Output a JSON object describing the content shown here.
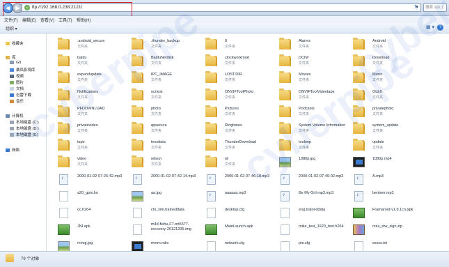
{
  "address": {
    "path": "ftp://192.168.0.238:2121/",
    "search_placeholder": "搜索 192.1..."
  },
  "menu": [
    "文件(F)",
    "编辑(E)",
    "查看(V)",
    "工具(T)",
    "帮助(H)"
  ],
  "toolbar": {
    "organize": "组织 ▾"
  },
  "sidebar": {
    "favorites": "收藏夹",
    "libraries": "库",
    "lib_items": [
      "Git",
      "暴风影视库",
      "视频",
      "图片",
      "文档",
      "迅雷下载",
      "音乐"
    ],
    "computer": "计算机",
    "drives": [
      "本地磁盘 (C:)",
      "本地磁盘 (D:)",
      "本地磁盘 (E:)"
    ],
    "network": "网络"
  },
  "folder_type": "文件夹",
  "items": [
    {
      "name": ".android_secure",
      "kind": "folder"
    },
    {
      "name": ".thunder_backup",
      "kind": "folder"
    },
    {
      "name": "0",
      "kind": "folder"
    },
    {
      "name": "Alarms",
      "kind": "folder"
    },
    {
      "name": "Android",
      "kind": "folder"
    },
    {
      "name": "baidu",
      "kind": "folder"
    },
    {
      "name": "BaiduNetdisk",
      "kind": "folder"
    },
    {
      "name": "clockworkmod",
      "kind": "folder"
    },
    {
      "name": "DCIM",
      "kind": "folder"
    },
    {
      "name": "Download",
      "kind": "folder"
    },
    {
      "name": "expandupdate",
      "kind": "folder"
    },
    {
      "name": "IPC_IMAGE",
      "kind": "folder"
    },
    {
      "name": "LOST.DIR",
      "kind": "folder"
    },
    {
      "name": "Movies",
      "kind": "folder"
    },
    {
      "name": "Music",
      "kind": "folder"
    },
    {
      "name": "Notifications",
      "kind": "folder"
    },
    {
      "name": "ocrtest",
      "kind": "folder"
    },
    {
      "name": "ONVIFToolPhoto",
      "kind": "folder"
    },
    {
      "name": "ONVIFToolVideotape",
      "kind": "folder"
    },
    {
      "name": "Otdr0",
      "kind": "folder"
    },
    {
      "name": "PFDOWNLOAD",
      "kind": "folder"
    },
    {
      "name": "photo",
      "kind": "folder"
    },
    {
      "name": "Pictures",
      "kind": "folder"
    },
    {
      "name": "Podcasts",
      "kind": "folder"
    },
    {
      "name": "privatephoto",
      "kind": "folder"
    },
    {
      "name": "privatevideo",
      "kind": "folder"
    },
    {
      "name": "qqsecure",
      "kind": "folder"
    },
    {
      "name": "Ringtones",
      "kind": "folder"
    },
    {
      "name": "System Volume Information",
      "kind": "folder"
    },
    {
      "name": "system_update",
      "kind": "folder"
    },
    {
      "name": "tape",
      "kind": "folder"
    },
    {
      "name": "tessdata",
      "kind": "folder"
    },
    {
      "name": "ThunderDownload",
      "kind": "folder"
    },
    {
      "name": "tooloop",
      "kind": "folder"
    },
    {
      "name": "update",
      "kind": "folder"
    },
    {
      "name": "video",
      "kind": "folder"
    },
    {
      "name": "wilson",
      "kind": "folder"
    },
    {
      "name": "wl",
      "kind": "folder"
    },
    {
      "name": "1080p.jpg",
      "kind": "image"
    },
    {
      "name": "1080p.mp4",
      "kind": "video"
    },
    {
      "name": "2000-01-02-07-26-42.mp3",
      "kind": "audio"
    },
    {
      "name": "2000-01-02-07-42-14.mp3",
      "kind": "audio"
    },
    {
      "name": "2000-01-02-07-46-18.mp3",
      "kind": "audio"
    },
    {
      "name": "2000-01-02-07-49-02.mp3",
      "kind": "audio"
    },
    {
      "name": "A.mp3",
      "kind": "audio"
    },
    {
      "name": "a20_gpio.ko",
      "kind": "file"
    },
    {
      "name": "aa.jpg",
      "kind": "image"
    },
    {
      "name": "aaaaaa.mp3",
      "kind": "audio"
    },
    {
      "name": "Be My Girl.mp3.mp3",
      "kind": "audio"
    },
    {
      "name": "benben.mp3",
      "kind": "audio"
    },
    {
      "name": "cc.h264",
      "kind": "file"
    },
    {
      "name": "chi_sim.traineddata",
      "kind": "file"
    },
    {
      "name": "desktop.cfg",
      "kind": "cfg"
    },
    {
      "name": "eng.traineddata",
      "kind": "file"
    },
    {
      "name": "Framaroot-v1.9.1cn.apk",
      "kind": "app"
    },
    {
      "name": "JNI.apk",
      "kind": "app"
    },
    {
      "name": "m4d-feihu-F7-mt6577-recovery-20121205.img",
      "kind": "file"
    },
    {
      "name": "MainLaunch.apk",
      "kind": "app"
    },
    {
      "name": "mike_test_1920_test.h264",
      "kind": "file"
    },
    {
      "name": "miui_stw_sign.zip",
      "kind": "zip"
    },
    {
      "name": "mmqj.jpg",
      "kind": "image"
    },
    {
      "name": "mmm.mkv",
      "kind": "video"
    },
    {
      "name": "network.cfg",
      "kind": "cfg"
    },
    {
      "name": "pts.cfg",
      "kind": "cfg"
    },
    {
      "name": "sssss.txt",
      "kind": "file"
    }
  ],
  "status": {
    "count": "79 个对象"
  },
  "watermark": [
    "cyberpipe",
    "cyberpipe",
    "cyber"
  ]
}
